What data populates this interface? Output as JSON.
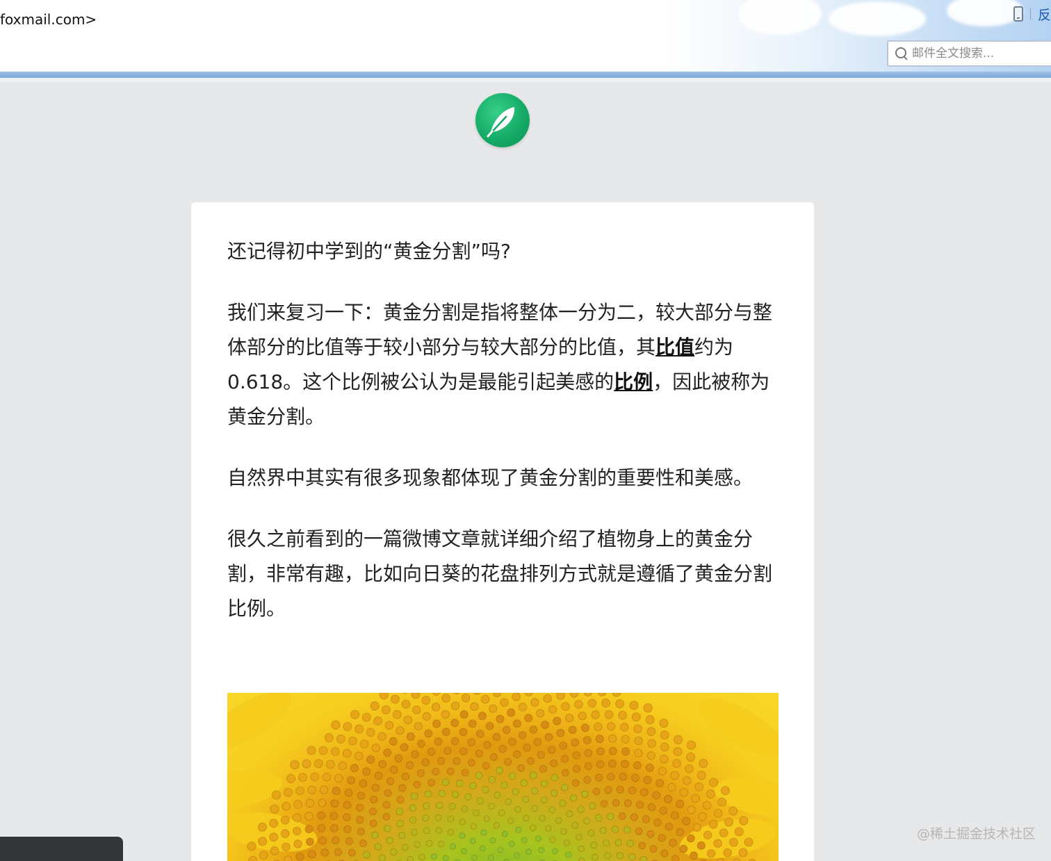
{
  "header": {
    "sender_tail": "foxmail.com>",
    "top_link": "反",
    "search": {
      "placeholder": "邮件全文搜索..."
    }
  },
  "article": {
    "paragraphs": {
      "p1": "还记得初中学到的“黄金分割”吗?",
      "p2_a": "我们来复习一下：黄金分割是指将整体一分为二，较大部分与整体部分的比值等于较小部分与较大部分的比值，其",
      "p2_link1": "比值",
      "p2_b": "约为0.618。这个比例被公认为是最能引起美感的",
      "p2_link2": "比例",
      "p2_c": "，因此被称为黄金分割。",
      "p3": "自然界中其实有很多现象都体现了黄金分割的重要性和美感。",
      "p4": "很久之前看到的一篇微博文章就详细介绍了植物身上的黄金分割，非常有趣，比如向日葵的花盘排列方式就是遵循了黄金分割比例。"
    }
  },
  "watermark": "@稀土掘金技术社区",
  "colors": {
    "logo_green": "#13a864",
    "page_bg": "#e7e8ea",
    "divider_blue": "#7aa6d8"
  }
}
